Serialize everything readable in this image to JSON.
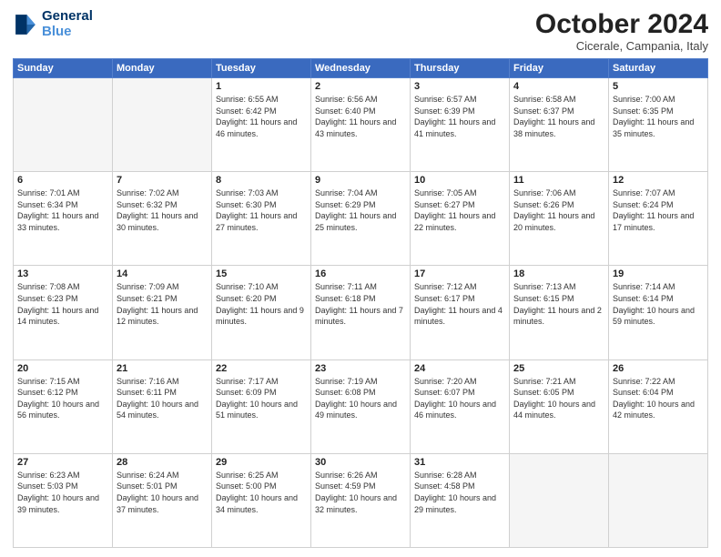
{
  "header": {
    "logo_line1": "General",
    "logo_line2": "Blue",
    "month_title": "October 2024",
    "location": "Cicerale, Campania, Italy"
  },
  "weekdays": [
    "Sunday",
    "Monday",
    "Tuesday",
    "Wednesday",
    "Thursday",
    "Friday",
    "Saturday"
  ],
  "weeks": [
    [
      {
        "day": "",
        "sunrise": "",
        "sunset": "",
        "daylight": "",
        "empty": true
      },
      {
        "day": "",
        "sunrise": "",
        "sunset": "",
        "daylight": "",
        "empty": true
      },
      {
        "day": "1",
        "sunrise": "Sunrise: 6:55 AM",
        "sunset": "Sunset: 6:42 PM",
        "daylight": "Daylight: 11 hours and 46 minutes.",
        "empty": false
      },
      {
        "day": "2",
        "sunrise": "Sunrise: 6:56 AM",
        "sunset": "Sunset: 6:40 PM",
        "daylight": "Daylight: 11 hours and 43 minutes.",
        "empty": false
      },
      {
        "day": "3",
        "sunrise": "Sunrise: 6:57 AM",
        "sunset": "Sunset: 6:39 PM",
        "daylight": "Daylight: 11 hours and 41 minutes.",
        "empty": false
      },
      {
        "day": "4",
        "sunrise": "Sunrise: 6:58 AM",
        "sunset": "Sunset: 6:37 PM",
        "daylight": "Daylight: 11 hours and 38 minutes.",
        "empty": false
      },
      {
        "day": "5",
        "sunrise": "Sunrise: 7:00 AM",
        "sunset": "Sunset: 6:35 PM",
        "daylight": "Daylight: 11 hours and 35 minutes.",
        "empty": false
      }
    ],
    [
      {
        "day": "6",
        "sunrise": "Sunrise: 7:01 AM",
        "sunset": "Sunset: 6:34 PM",
        "daylight": "Daylight: 11 hours and 33 minutes.",
        "empty": false
      },
      {
        "day": "7",
        "sunrise": "Sunrise: 7:02 AM",
        "sunset": "Sunset: 6:32 PM",
        "daylight": "Daylight: 11 hours and 30 minutes.",
        "empty": false
      },
      {
        "day": "8",
        "sunrise": "Sunrise: 7:03 AM",
        "sunset": "Sunset: 6:30 PM",
        "daylight": "Daylight: 11 hours and 27 minutes.",
        "empty": false
      },
      {
        "day": "9",
        "sunrise": "Sunrise: 7:04 AM",
        "sunset": "Sunset: 6:29 PM",
        "daylight": "Daylight: 11 hours and 25 minutes.",
        "empty": false
      },
      {
        "day": "10",
        "sunrise": "Sunrise: 7:05 AM",
        "sunset": "Sunset: 6:27 PM",
        "daylight": "Daylight: 11 hours and 22 minutes.",
        "empty": false
      },
      {
        "day": "11",
        "sunrise": "Sunrise: 7:06 AM",
        "sunset": "Sunset: 6:26 PM",
        "daylight": "Daylight: 11 hours and 20 minutes.",
        "empty": false
      },
      {
        "day": "12",
        "sunrise": "Sunrise: 7:07 AM",
        "sunset": "Sunset: 6:24 PM",
        "daylight": "Daylight: 11 hours and 17 minutes.",
        "empty": false
      }
    ],
    [
      {
        "day": "13",
        "sunrise": "Sunrise: 7:08 AM",
        "sunset": "Sunset: 6:23 PM",
        "daylight": "Daylight: 11 hours and 14 minutes.",
        "empty": false
      },
      {
        "day": "14",
        "sunrise": "Sunrise: 7:09 AM",
        "sunset": "Sunset: 6:21 PM",
        "daylight": "Daylight: 11 hours and 12 minutes.",
        "empty": false
      },
      {
        "day": "15",
        "sunrise": "Sunrise: 7:10 AM",
        "sunset": "Sunset: 6:20 PM",
        "daylight": "Daylight: 11 hours and 9 minutes.",
        "empty": false
      },
      {
        "day": "16",
        "sunrise": "Sunrise: 7:11 AM",
        "sunset": "Sunset: 6:18 PM",
        "daylight": "Daylight: 11 hours and 7 minutes.",
        "empty": false
      },
      {
        "day": "17",
        "sunrise": "Sunrise: 7:12 AM",
        "sunset": "Sunset: 6:17 PM",
        "daylight": "Daylight: 11 hours and 4 minutes.",
        "empty": false
      },
      {
        "day": "18",
        "sunrise": "Sunrise: 7:13 AM",
        "sunset": "Sunset: 6:15 PM",
        "daylight": "Daylight: 11 hours and 2 minutes.",
        "empty": false
      },
      {
        "day": "19",
        "sunrise": "Sunrise: 7:14 AM",
        "sunset": "Sunset: 6:14 PM",
        "daylight": "Daylight: 10 hours and 59 minutes.",
        "empty": false
      }
    ],
    [
      {
        "day": "20",
        "sunrise": "Sunrise: 7:15 AM",
        "sunset": "Sunset: 6:12 PM",
        "daylight": "Daylight: 10 hours and 56 minutes.",
        "empty": false
      },
      {
        "day": "21",
        "sunrise": "Sunrise: 7:16 AM",
        "sunset": "Sunset: 6:11 PM",
        "daylight": "Daylight: 10 hours and 54 minutes.",
        "empty": false
      },
      {
        "day": "22",
        "sunrise": "Sunrise: 7:17 AM",
        "sunset": "Sunset: 6:09 PM",
        "daylight": "Daylight: 10 hours and 51 minutes.",
        "empty": false
      },
      {
        "day": "23",
        "sunrise": "Sunrise: 7:19 AM",
        "sunset": "Sunset: 6:08 PM",
        "daylight": "Daylight: 10 hours and 49 minutes.",
        "empty": false
      },
      {
        "day": "24",
        "sunrise": "Sunrise: 7:20 AM",
        "sunset": "Sunset: 6:07 PM",
        "daylight": "Daylight: 10 hours and 46 minutes.",
        "empty": false
      },
      {
        "day": "25",
        "sunrise": "Sunrise: 7:21 AM",
        "sunset": "Sunset: 6:05 PM",
        "daylight": "Daylight: 10 hours and 44 minutes.",
        "empty": false
      },
      {
        "day": "26",
        "sunrise": "Sunrise: 7:22 AM",
        "sunset": "Sunset: 6:04 PM",
        "daylight": "Daylight: 10 hours and 42 minutes.",
        "empty": false
      }
    ],
    [
      {
        "day": "27",
        "sunrise": "Sunrise: 6:23 AM",
        "sunset": "Sunset: 5:03 PM",
        "daylight": "Daylight: 10 hours and 39 minutes.",
        "empty": false
      },
      {
        "day": "28",
        "sunrise": "Sunrise: 6:24 AM",
        "sunset": "Sunset: 5:01 PM",
        "daylight": "Daylight: 10 hours and 37 minutes.",
        "empty": false
      },
      {
        "day": "29",
        "sunrise": "Sunrise: 6:25 AM",
        "sunset": "Sunset: 5:00 PM",
        "daylight": "Daylight: 10 hours and 34 minutes.",
        "empty": false
      },
      {
        "day": "30",
        "sunrise": "Sunrise: 6:26 AM",
        "sunset": "Sunset: 4:59 PM",
        "daylight": "Daylight: 10 hours and 32 minutes.",
        "empty": false
      },
      {
        "day": "31",
        "sunrise": "Sunrise: 6:28 AM",
        "sunset": "Sunset: 4:58 PM",
        "daylight": "Daylight: 10 hours and 29 minutes.",
        "empty": false
      },
      {
        "day": "",
        "sunrise": "",
        "sunset": "",
        "daylight": "",
        "empty": true
      },
      {
        "day": "",
        "sunrise": "",
        "sunset": "",
        "daylight": "",
        "empty": true
      }
    ]
  ]
}
